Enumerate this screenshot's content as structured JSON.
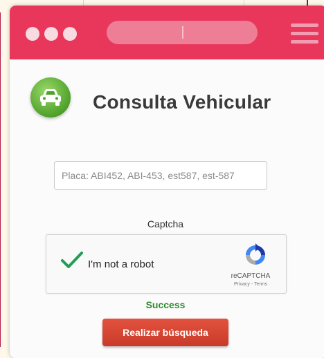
{
  "colors": {
    "titlebar": "#e8375b",
    "accent_button": "#d8432f",
    "success": "#2e8a2e"
  },
  "app": {
    "title": "Consulta Vehicular",
    "logo_icon": "car-icon"
  },
  "form": {
    "plate_placeholder": "Placa: ABI452, ABI-453, est587, est-587",
    "plate_value": "",
    "captcha_label": "Captcha",
    "recaptcha": {
      "checkbox_label": "I'm not a robot",
      "checked": true,
      "brand": "reCAPTCHA",
      "links": "Privacy - Terms"
    },
    "status": "Success",
    "submit_label": "Realizar búsqueda"
  }
}
